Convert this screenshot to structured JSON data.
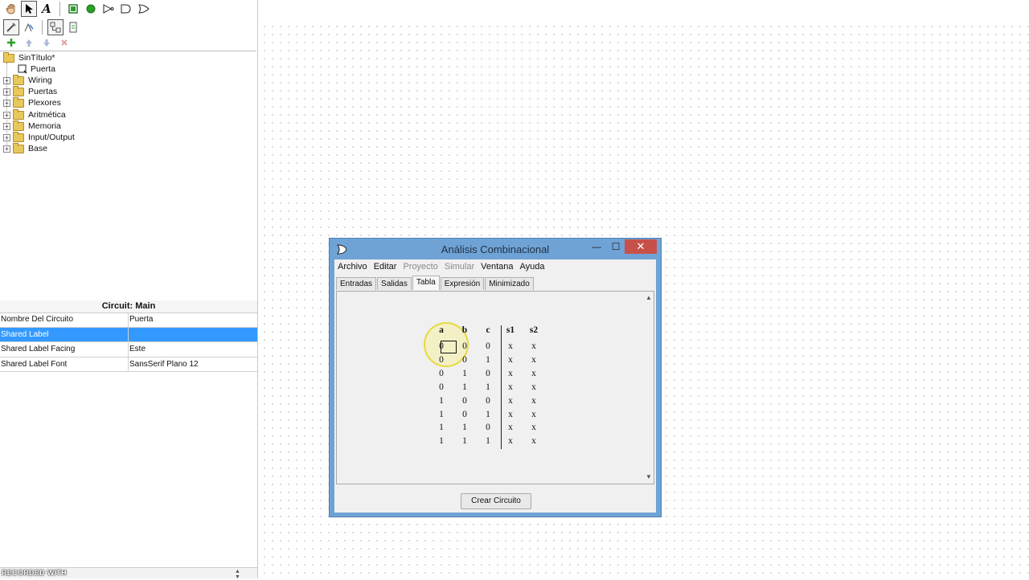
{
  "tree": {
    "root": "SinTítulo*",
    "circuit": "Puerta",
    "folders": [
      "Wiring",
      "Puertas",
      "Plexores",
      "Aritmética",
      "Memoria",
      "Input/Output",
      "Base"
    ]
  },
  "props": {
    "title": "Circuit: Main",
    "rows": [
      {
        "key": "Nombre Del Circuito",
        "value": "Puerta"
      },
      {
        "key": "Shared Label",
        "value": ""
      },
      {
        "key": "Shared Label Facing",
        "value": "Este"
      },
      {
        "key": "Shared Label Font",
        "value": "SansSerif Plano 12"
      }
    ]
  },
  "watermark": "RECORDED WITH",
  "dialog": {
    "title": "Análisis Combinacional",
    "menus": [
      "Archivo",
      "Editar",
      "Proyecto",
      "Simular",
      "Ventana",
      "Ayuda"
    ],
    "tabs": [
      "Entradas",
      "Salidas",
      "Tabla",
      "Expresión",
      "Minimizado"
    ],
    "active_tab": "Tabla",
    "create_button": "Crear Circuito",
    "truth_table": {
      "headers": [
        "a",
        "b",
        "c",
        "s1",
        "s2"
      ],
      "rows": [
        [
          "0",
          "0",
          "0",
          "x",
          "x"
        ],
        [
          "0",
          "0",
          "1",
          "x",
          "x"
        ],
        [
          "0",
          "1",
          "0",
          "x",
          "x"
        ],
        [
          "0",
          "1",
          "1",
          "x",
          "x"
        ],
        [
          "1",
          "0",
          "0",
          "x",
          "x"
        ],
        [
          "1",
          "0",
          "1",
          "x",
          "x"
        ],
        [
          "1",
          "1",
          "0",
          "x",
          "x"
        ],
        [
          "1",
          "1",
          "1",
          "x",
          "x"
        ]
      ]
    }
  },
  "colors": {
    "dialog_frame": "#6fa3d6",
    "selection": "#3399ff",
    "close_button": "#c7514a",
    "start_icon": "#2aa02a"
  }
}
